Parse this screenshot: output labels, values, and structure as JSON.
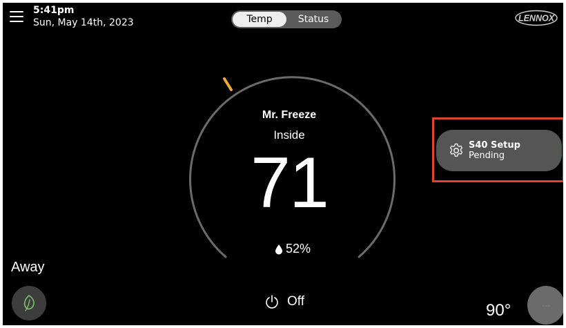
{
  "header": {
    "time": "5:41pm",
    "date": "Sun, May 14th, 2023",
    "tabs": [
      {
        "label": "Temp",
        "active": true
      },
      {
        "label": "Status",
        "active": false
      }
    ],
    "brand": "LENNOX"
  },
  "zone": {
    "name": "Mr. Freeze",
    "location_label": "Inside",
    "temperature": "71",
    "humidity": "52%"
  },
  "system": {
    "mode_label": "Off"
  },
  "away": {
    "label": "Away"
  },
  "outdoor": {
    "temperature": "90°"
  },
  "fan": {
    "label": "---"
  },
  "setup_card": {
    "title": "S40 Setup",
    "status": "Pending"
  },
  "colors": {
    "background": "#000000",
    "accent_marker": "#f2a93b",
    "highlight_border": "#e0452d",
    "card": "#555555",
    "away_leaf": "#7cc26a"
  },
  "icons": [
    "menu-icon",
    "gear-icon",
    "humidity-drop-icon",
    "power-icon",
    "leaf-icon"
  ]
}
